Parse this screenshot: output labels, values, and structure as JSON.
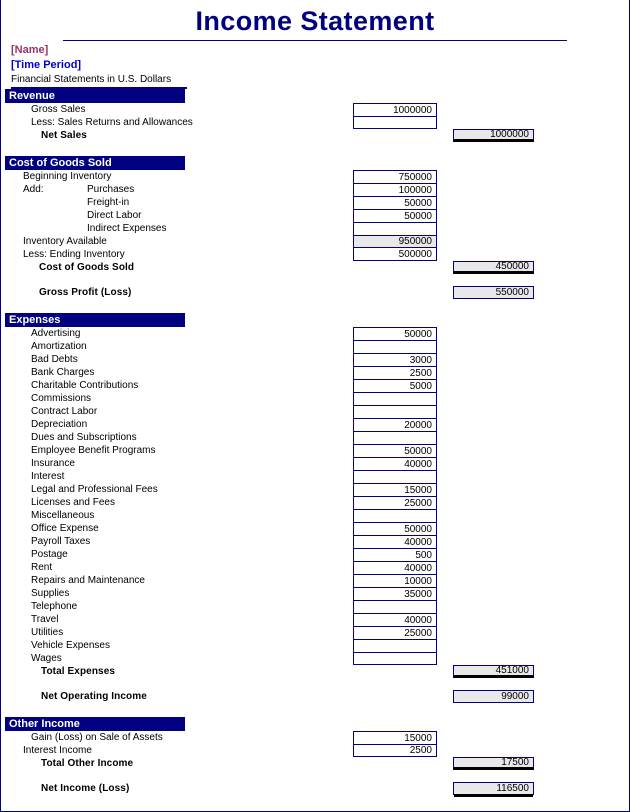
{
  "document": {
    "title": "Income Statement",
    "company_name": "[Name]",
    "time_period": "[Time Period]",
    "currency_note": "Financial Statements in U.S. Dollars"
  },
  "colors": {
    "title": "#000080",
    "section_bar": "#000080",
    "section_bar_text": "#FFFFFF",
    "company_name": "#993366",
    "time_period": "#0000CC",
    "shaded_cell": "#E8E8E8",
    "cell_border": "#000080"
  },
  "sections": {
    "revenue": {
      "header": "Revenue",
      "rows": [
        {
          "label": "Gross Sales",
          "sub": "1000000",
          "total": ""
        },
        {
          "label": "Less: Sales Returns and Allowances",
          "sub": "",
          "total": ""
        }
      ],
      "subtotal": {
        "label": "Net Sales",
        "total": "1000000"
      }
    },
    "cogs": {
      "header": "Cost of Goods Sold",
      "rows": [
        {
          "label": "Beginning Inventory",
          "prefix": "",
          "sub": "750000"
        },
        {
          "label": "Purchases",
          "prefix": "Add:",
          "sub": "100000"
        },
        {
          "label": "Freight-in",
          "prefix": "",
          "sub": "50000"
        },
        {
          "label": "Direct Labor",
          "prefix": "",
          "sub": "50000"
        },
        {
          "label": "Indirect Expenses",
          "prefix": "",
          "sub": ""
        },
        {
          "label": "Inventory Available",
          "prefix": "",
          "sub": "950000"
        },
        {
          "label": "Less: Ending Inventory",
          "prefix": "",
          "sub": "500000"
        }
      ],
      "subtotal": {
        "label": "Cost of Goods Sold",
        "total": "450000"
      },
      "gross_profit": {
        "label": "Gross Profit (Loss)",
        "total": "550000"
      }
    },
    "expenses": {
      "header": "Expenses",
      "rows": [
        {
          "label": "Advertising",
          "sub": "50000"
        },
        {
          "label": "Amortization",
          "sub": ""
        },
        {
          "label": "Bad Debts",
          "sub": "3000"
        },
        {
          "label": "Bank Charges",
          "sub": "2500"
        },
        {
          "label": "Charitable Contributions",
          "sub": "5000"
        },
        {
          "label": "Commissions",
          "sub": ""
        },
        {
          "label": "Contract Labor",
          "sub": ""
        },
        {
          "label": "Depreciation",
          "sub": "20000"
        },
        {
          "label": "Dues and Subscriptions",
          "sub": ""
        },
        {
          "label": "Employee Benefit Programs",
          "sub": "50000"
        },
        {
          "label": "Insurance",
          "sub": "40000"
        },
        {
          "label": "Interest",
          "sub": ""
        },
        {
          "label": "Legal and Professional Fees",
          "sub": "15000"
        },
        {
          "label": "Licenses and Fees",
          "sub": "25000"
        },
        {
          "label": "Miscellaneous",
          "sub": ""
        },
        {
          "label": "Office Expense",
          "sub": "50000"
        },
        {
          "label": "Payroll Taxes",
          "sub": "40000"
        },
        {
          "label": "Postage",
          "sub": "500"
        },
        {
          "label": "Rent",
          "sub": "40000"
        },
        {
          "label": "Repairs and Maintenance",
          "sub": "10000"
        },
        {
          "label": "Supplies",
          "sub": "35000"
        },
        {
          "label": "Telephone",
          "sub": ""
        },
        {
          "label": "Travel",
          "sub": "40000"
        },
        {
          "label": "Utilities",
          "sub": "25000"
        },
        {
          "label": "Vehicle Expenses",
          "sub": ""
        },
        {
          "label": "Wages",
          "sub": ""
        }
      ],
      "subtotal": {
        "label": "Total Expenses",
        "total": "451000"
      },
      "net_operating_income": {
        "label": "Net Operating Income",
        "total": "99000"
      }
    },
    "other_income": {
      "header": "Other Income",
      "rows": [
        {
          "label": "Gain (Loss) on Sale of Assets",
          "sub": "15000"
        },
        {
          "label": "Interest Income",
          "sub": "2500"
        }
      ],
      "subtotal": {
        "label": "Total Other Income",
        "total": "17500"
      },
      "net_income": {
        "label": "Net Income (Loss)",
        "total": "116500"
      }
    }
  }
}
